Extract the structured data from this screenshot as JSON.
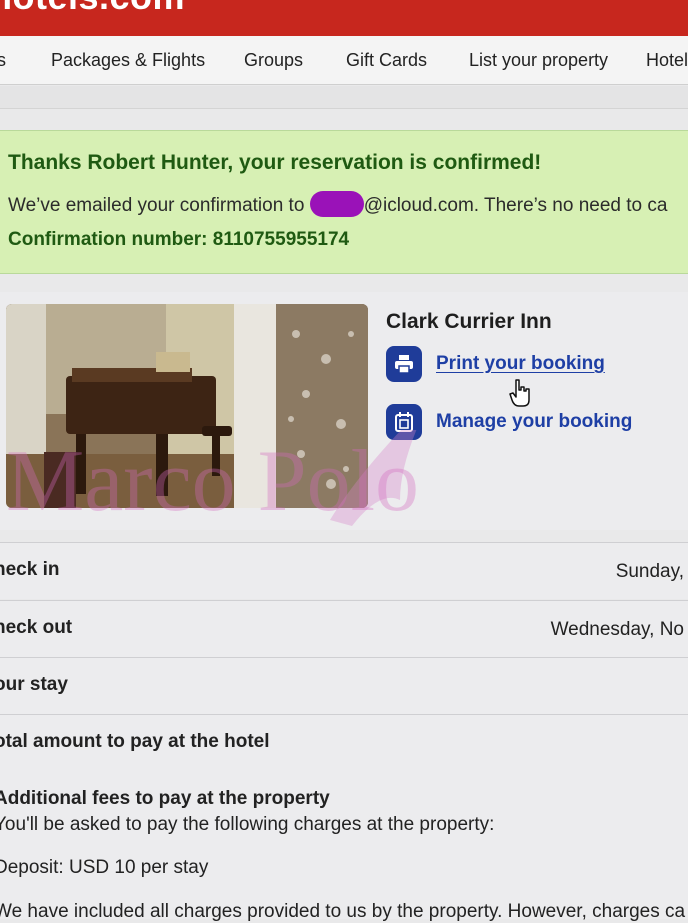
{
  "brand": {
    "logo_text": "hotels.com",
    "color": "#c7271e"
  },
  "nav": {
    "items": [
      "s",
      "Packages & Flights",
      "Groups",
      "Gift Cards",
      "List your property",
      "Hotels"
    ]
  },
  "confirmation": {
    "title": "Thanks Robert Hunter, your reservation is confirmed!",
    "email_prefix": "We’ve emailed your confirmation to",
    "email_suffix": "@icloud.com. There’s no need to ca",
    "number_text": "Confirmation number: 8110755955174",
    "background_color": "#d7f0b4"
  },
  "hotel": {
    "name": "Clark Currier Inn",
    "photo_icon": "hotel-room-photo",
    "actions": [
      {
        "label": "Print your booking",
        "icon": "printer-icon"
      },
      {
        "label": "Manage your booking",
        "icon": "calendar-icon"
      }
    ]
  },
  "watermark": {
    "text": "Marco Polo"
  },
  "details": {
    "check_in_label": "heck in",
    "check_in_value": "Sunday,",
    "check_out_label": "heck out",
    "check_out_value": "Wednesday, No",
    "your_stay_label": "our stay",
    "total_label": "otal amount to pay at the hotel"
  },
  "fees": {
    "heading": "Additional fees to pay at the property",
    "subtitle": "You'll be asked to pay the following charges at the property:",
    "deposit": "Deposit: USD 10 per stay",
    "disclaimer": "We have included all charges provided to us by the property. However, charges ca"
  },
  "colors": {
    "accent": "#1e3fa5",
    "icon_bg": "#1f3c99",
    "redaction": "#9a12b8"
  }
}
